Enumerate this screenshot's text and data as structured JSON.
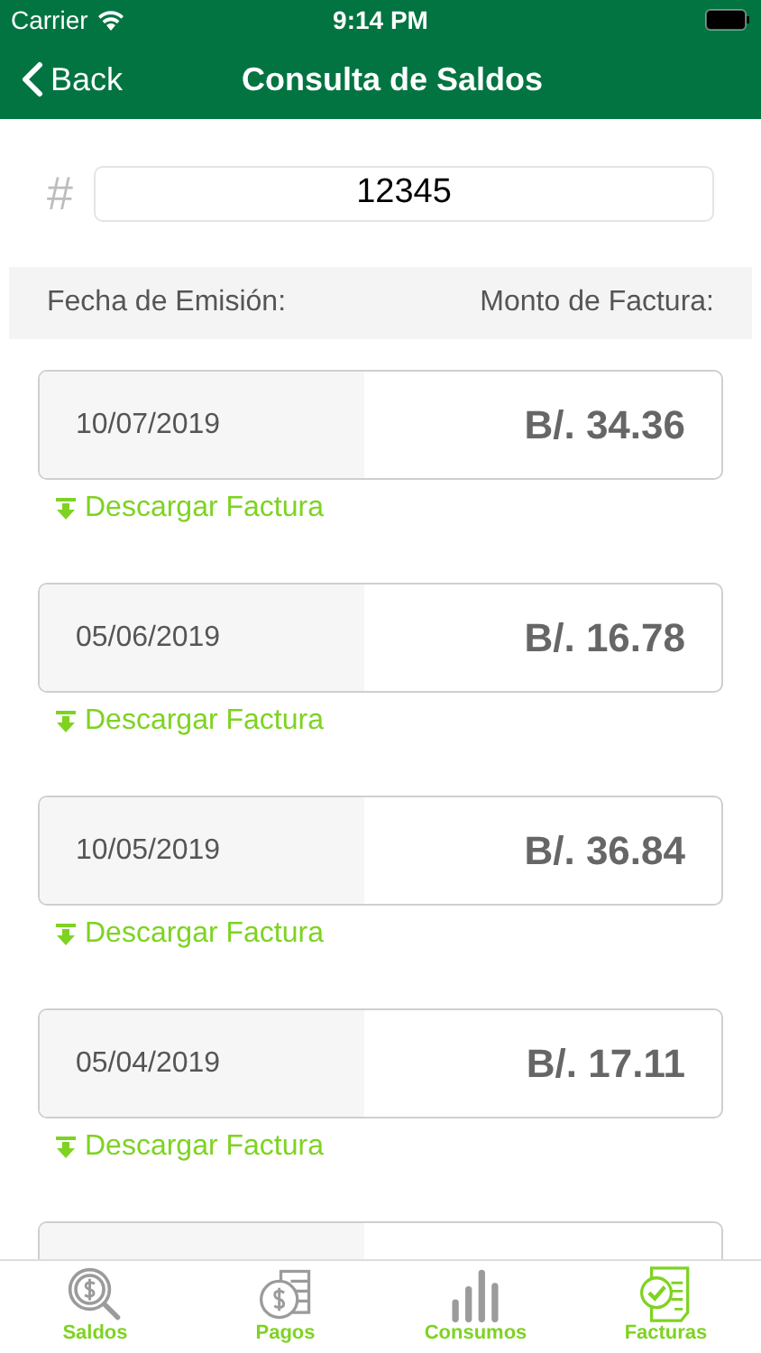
{
  "status_bar": {
    "carrier": "Carrier",
    "time": "9:14 PM"
  },
  "nav": {
    "back": "Back",
    "title": "Consulta de Saldos"
  },
  "search": {
    "prefix": "#",
    "value": "12345"
  },
  "columns": [
    "Fecha de Emisión:",
    "Monto de Factura:"
  ],
  "invoices": [
    {
      "date": "10/07/2019",
      "amount": "B/. 34.36",
      "download": "Descargar Factura"
    },
    {
      "date": "05/06/2019",
      "amount": "B/. 16.78",
      "download": "Descargar Factura"
    },
    {
      "date": "10/05/2019",
      "amount": "B/. 36.84",
      "download": "Descargar Factura"
    },
    {
      "date": "05/04/2019",
      "amount": "B/. 17.11",
      "download": "Descargar Factura"
    }
  ],
  "tabs": [
    {
      "label": "Saldos",
      "kind": "saldos",
      "selected": false
    },
    {
      "label": "Pagos",
      "kind": "pagos",
      "selected": false
    },
    {
      "label": "Consumos",
      "kind": "consumos",
      "selected": false
    },
    {
      "label": "Facturas",
      "kind": "facturas",
      "selected": true
    }
  ]
}
